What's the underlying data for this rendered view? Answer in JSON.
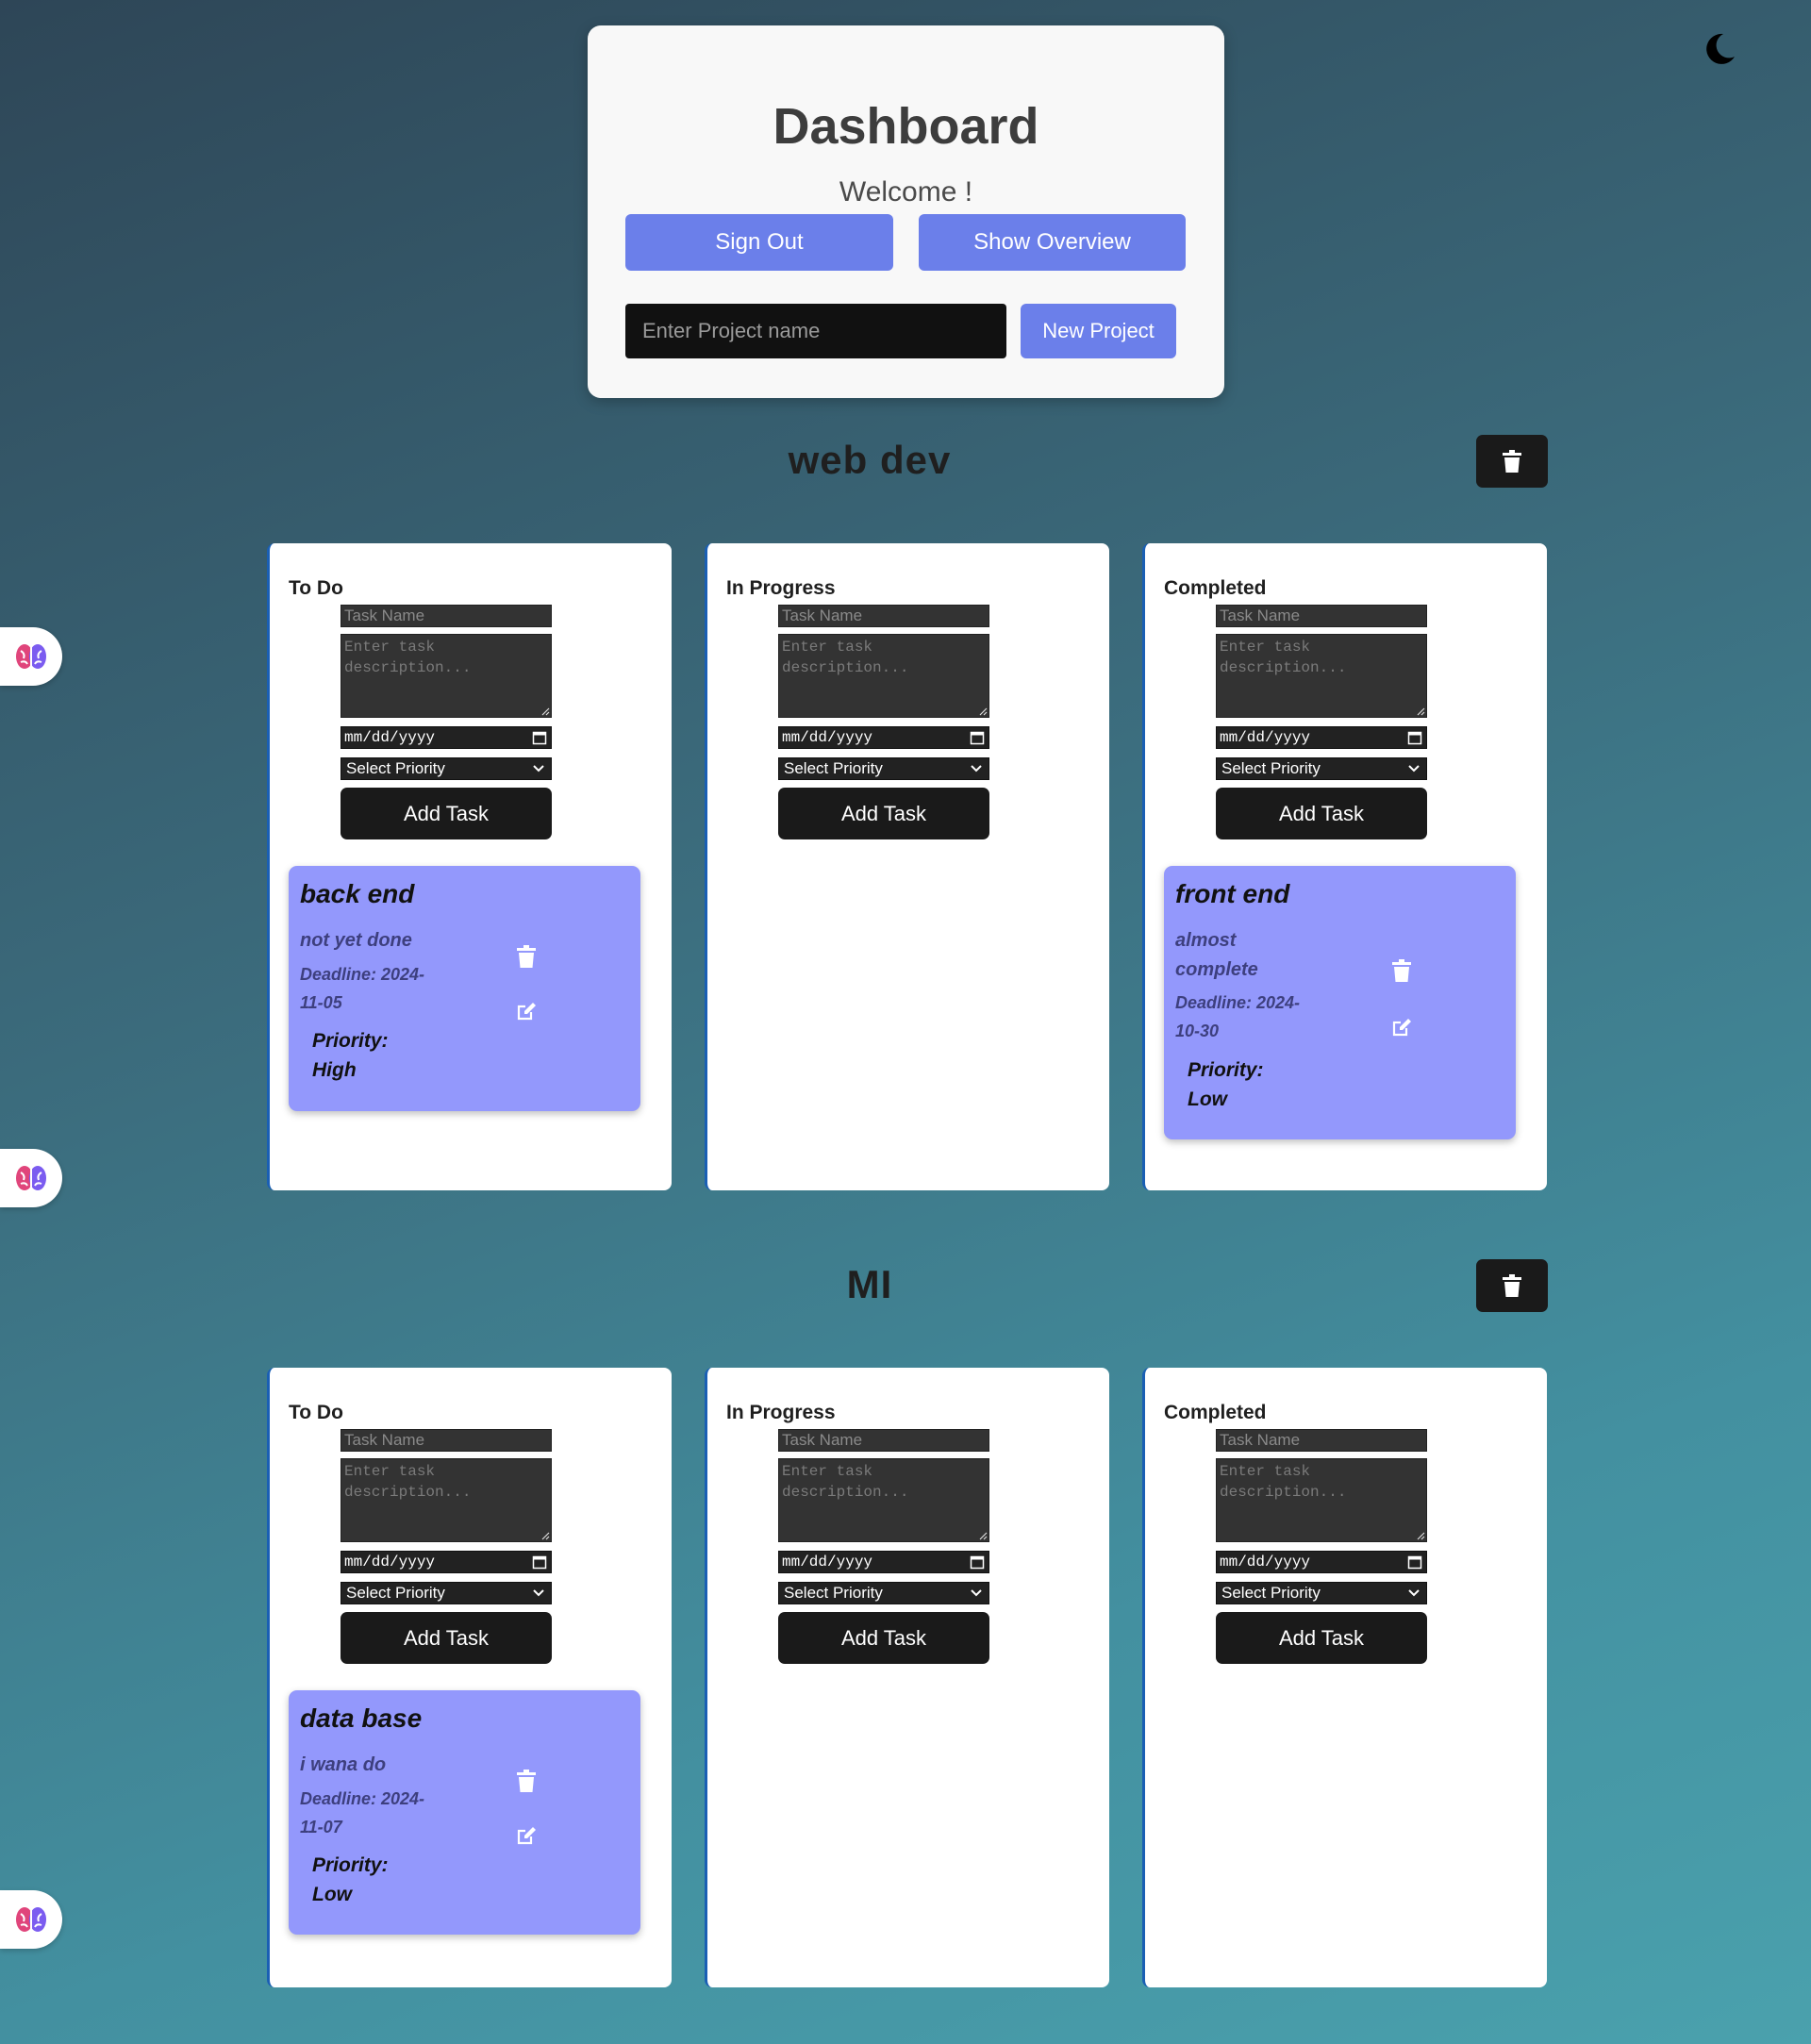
{
  "header": {
    "title": "Dashboard",
    "welcome": "Welcome !",
    "signout_label": "Sign Out",
    "overview_label": "Show Overview",
    "project_placeholder": "Enter Project name",
    "new_project_label": "New Project"
  },
  "theme": {
    "toggle_icon": "moon-icon"
  },
  "side_badges": {
    "icon": "brain-icon"
  },
  "form": {
    "task_name_placeholder": "Task Name",
    "description_placeholder": "Enter task description...",
    "date_placeholder": "mm/dd/yyyy",
    "priority_label": "Select Priority",
    "add_task_label": "Add Task"
  },
  "colors": {
    "accent": "#6b7fea",
    "task_card": "#9398fc",
    "dark_button": "#1a1a1a"
  },
  "projects": [
    {
      "name": "web dev",
      "columns": [
        {
          "title": "To Do",
          "tasks": [
            {
              "title": "back end",
              "description": "not yet done",
              "deadline": "Deadline: 2024-11-05",
              "priority": "Priority: High"
            }
          ]
        },
        {
          "title": "In Progress",
          "tasks": []
        },
        {
          "title": "Completed",
          "tasks": [
            {
              "title": "front end",
              "description": "almost complete",
              "deadline": "Deadline: 2024-10-30",
              "priority": "Priority: Low"
            }
          ]
        }
      ]
    },
    {
      "name": "MI",
      "columns": [
        {
          "title": "To Do",
          "tasks": [
            {
              "title": "data base",
              "description": "i wana do",
              "deadline": "Deadline: 2024-11-07",
              "priority": "Priority: Low"
            }
          ]
        },
        {
          "title": "In Progress",
          "tasks": []
        },
        {
          "title": "Completed",
          "tasks": []
        }
      ]
    }
  ]
}
